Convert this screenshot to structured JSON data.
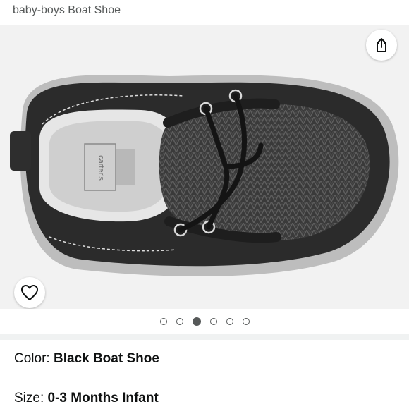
{
  "product": {
    "title": "baby-boys Boat Shoe"
  },
  "gallery": {
    "image_alt": "Black boat shoe with herringbone tweed vamp and carter's insole",
    "insole_brand": "carter's",
    "share_icon": "share-icon",
    "favorite_icon": "heart-outline-icon",
    "dots_count": 6,
    "active_dot_index": 2
  },
  "attributes": {
    "color_label": "Color: ",
    "color_value": "Black Boat Shoe",
    "size_label": "Size: ",
    "size_value": "0-3 Months Infant"
  },
  "colors": {
    "gallery_bg": "#f2f2f2",
    "text": "#0f1111",
    "muted": "#565959"
  }
}
